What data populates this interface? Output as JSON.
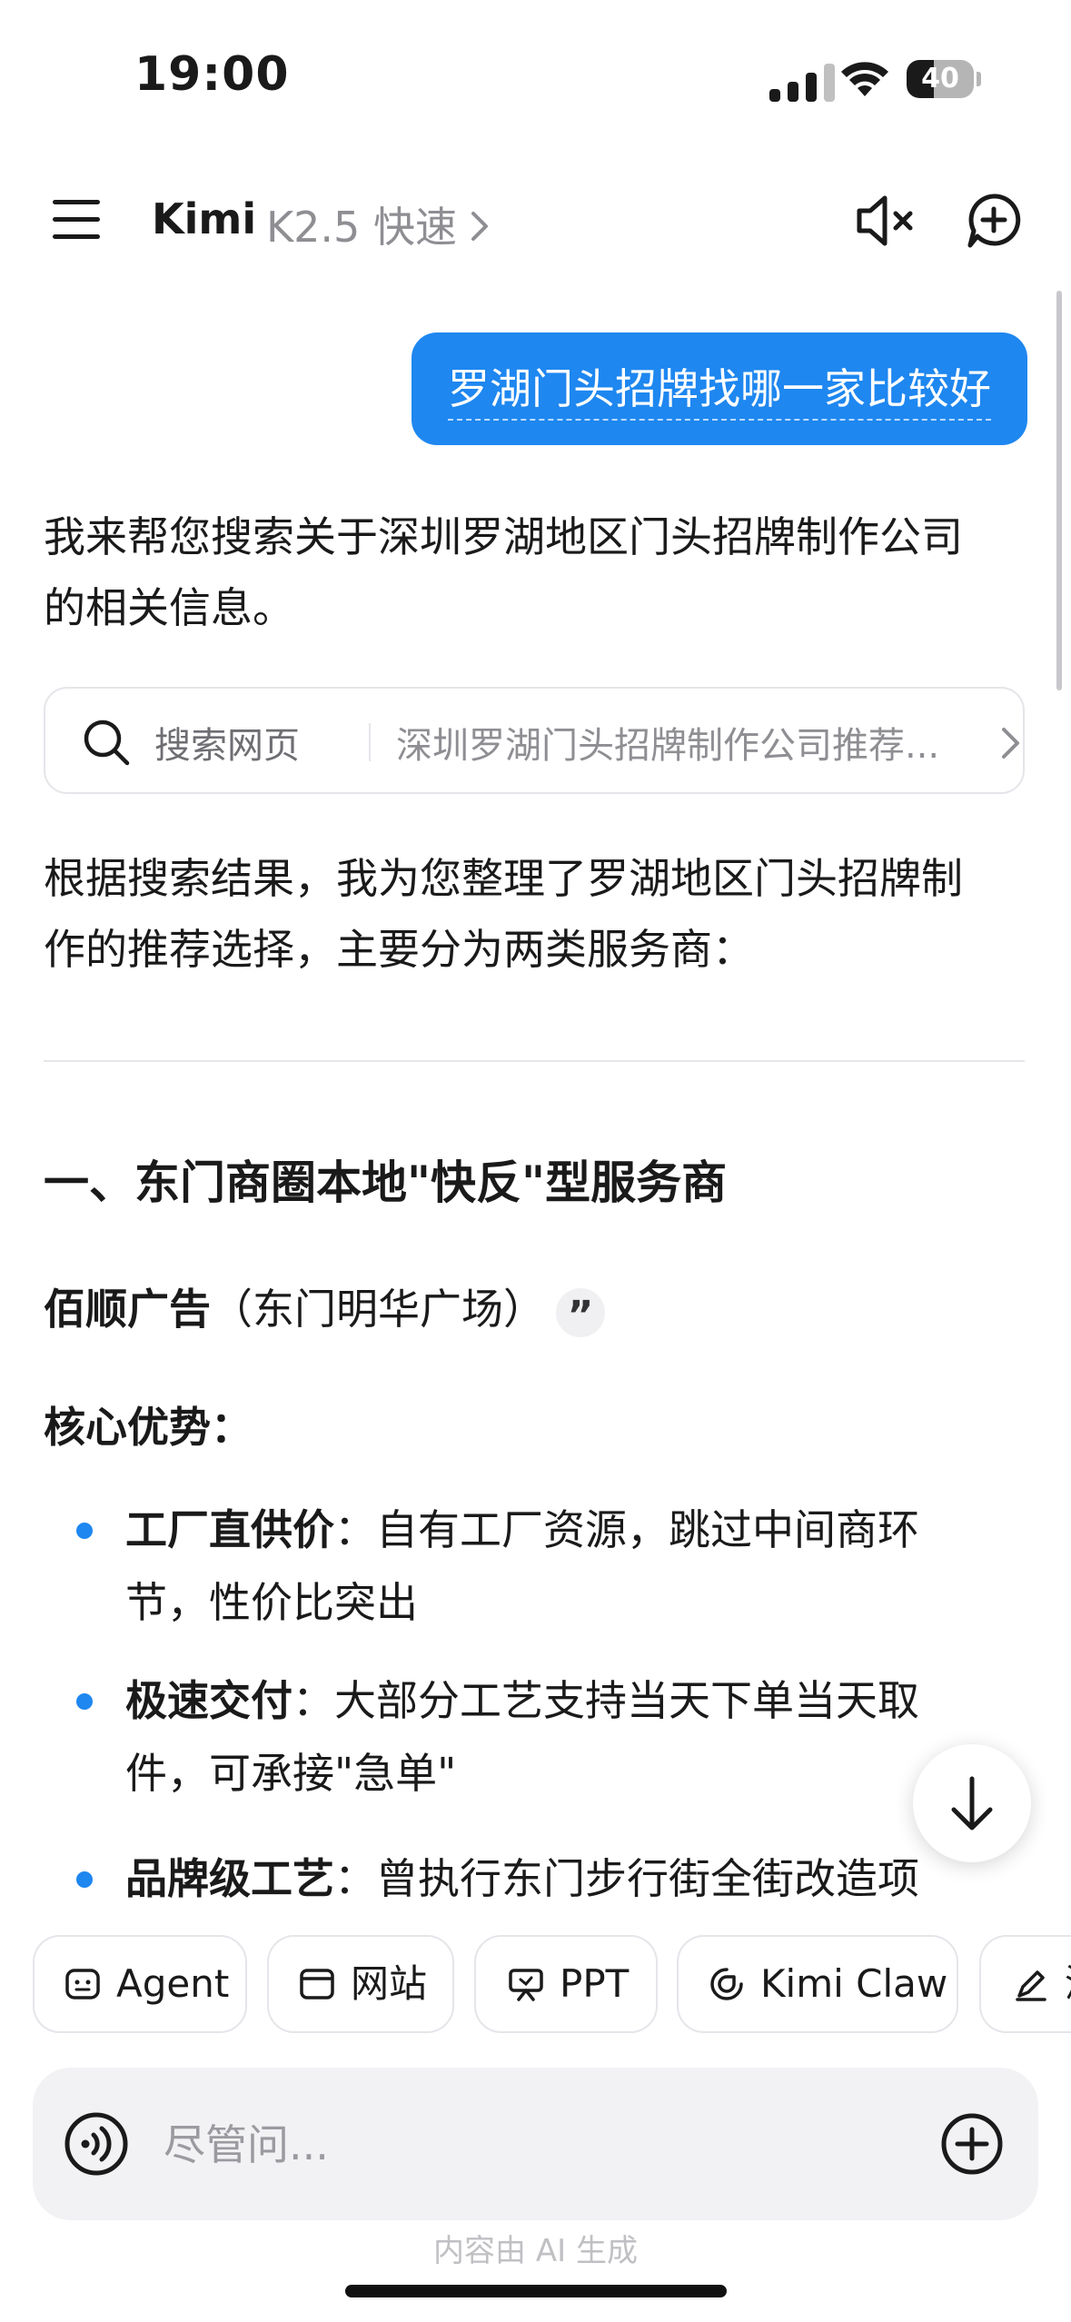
{
  "status_bar": {
    "time": "19:00",
    "battery": "40",
    "battery_level": 0.4
  },
  "header": {
    "app_name": "Kimi",
    "model": "K2.5 快速"
  },
  "chat": {
    "user_message": "罗湖门头招牌找哪一家比较好",
    "intro": [
      "我来帮您搜索关于深圳罗湖地区门头招牌制作公司",
      "的相关信息。"
    ],
    "search_card": {
      "label": "搜索网页",
      "query": "深圳罗湖门头招牌制作公司推荐..."
    },
    "summary": [
      "根据搜索结果，我为您整理了罗湖地区门头招牌制",
      "作的推荐选择，主要分为两类服务商："
    ],
    "section_title": "一、东门商圈本地\"快反\"型服务商",
    "company": {
      "name": "佰顺广告",
      "location": "（东门明华广场）",
      "cite_glyph": "”"
    },
    "core_title": "核心优势：",
    "bullets": [
      {
        "title": "工厂直供价",
        "sep": "：",
        "line1": "自有工厂资源，跳过中间商环",
        "line2": "节，性价比突出"
      },
      {
        "title": "极速交付",
        "sep": "：",
        "line1": "大部分工艺支持当天下单当天取",
        "line2": "件，可承接\"急单\""
      },
      {
        "title": "品牌级工艺",
        "sep": "：",
        "line1": "曾执行东门步行街全街改造项",
        "line2": ""
      }
    ]
  },
  "chips": [
    {
      "label": "Agent",
      "icon": "agent-icon"
    },
    {
      "label": "网站",
      "icon": "browser-window-icon"
    },
    {
      "label": "PPT",
      "icon": "presentation-icon"
    },
    {
      "label": "Kimi Claw",
      "icon": "claw-icon"
    },
    {
      "label": "深",
      "icon": "pen-icon"
    }
  ],
  "input": {
    "placeholder": "尽管问..."
  },
  "footer": {
    "disclaimer": "内容由 AI 生成"
  },
  "colors": {
    "accent": "#1e87f0",
    "muted": "#8e8e93",
    "border": "#e5e5ea",
    "input_bg": "#f2f2f4"
  }
}
